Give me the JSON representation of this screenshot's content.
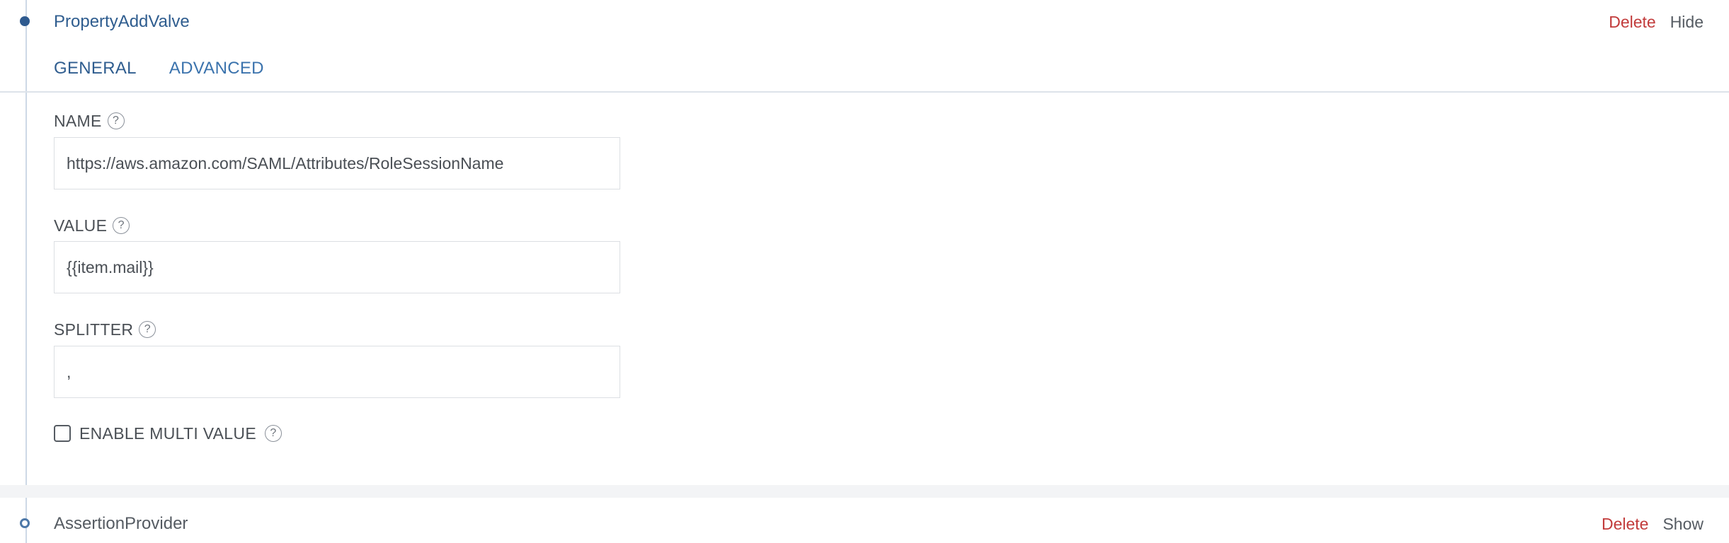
{
  "valve": {
    "title": "PropertyAddValve",
    "delete_label": "Delete",
    "toggle_label": "Hide",
    "tabs": [
      {
        "label": "GENERAL",
        "active": true
      },
      {
        "label": "ADVANCED",
        "active": false
      }
    ],
    "fields": {
      "name": {
        "label": "NAME",
        "value": "https://aws.amazon.com/SAML/Attributes/RoleSessionName"
      },
      "value": {
        "label": "VALUE",
        "value": "{{item.mail}}"
      },
      "splitter": {
        "label": "SPLITTER",
        "value": ","
      }
    },
    "multi_value": {
      "label": "ENABLE MULTI VALUE",
      "checked": false
    },
    "help_glyph": "?"
  },
  "provider": {
    "title": "AssertionProvider",
    "delete_label": "Delete",
    "toggle_label": "Show"
  },
  "colors": {
    "accent": "#2f5d8f",
    "danger": "#c23b3b",
    "timeline": "#cdd9e6"
  }
}
